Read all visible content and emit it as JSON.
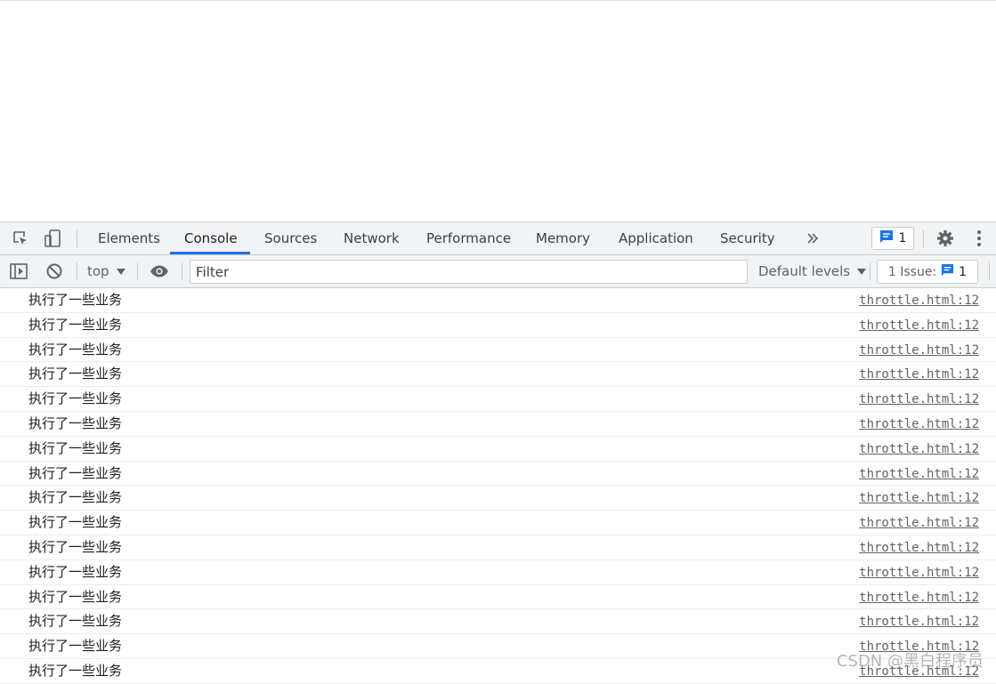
{
  "tabs": [
    "Elements",
    "Console",
    "Sources",
    "Network",
    "Performance",
    "Memory",
    "Application",
    "Security"
  ],
  "active_tab": "Console",
  "messages_badge": "1",
  "console_toolbar": {
    "context": "top",
    "filter_placeholder": "Filter",
    "levels": "Default levels",
    "issues_label": "1 Issue:",
    "issues_count": "1"
  },
  "log_rows": [
    {
      "message": "执行了一些业务",
      "source": "throttle.html:12"
    },
    {
      "message": "执行了一些业务",
      "source": "throttle.html:12"
    },
    {
      "message": "执行了一些业务",
      "source": "throttle.html:12"
    },
    {
      "message": "执行了一些业务",
      "source": "throttle.html:12"
    },
    {
      "message": "执行了一些业务",
      "source": "throttle.html:12"
    },
    {
      "message": "执行了一些业务",
      "source": "throttle.html:12"
    },
    {
      "message": "执行了一些业务",
      "source": "throttle.html:12"
    },
    {
      "message": "执行了一些业务",
      "source": "throttle.html:12"
    },
    {
      "message": "执行了一些业务",
      "source": "throttle.html:12"
    },
    {
      "message": "执行了一些业务",
      "source": "throttle.html:12"
    },
    {
      "message": "执行了一些业务",
      "source": "throttle.html:12"
    },
    {
      "message": "执行了一些业务",
      "source": "throttle.html:12"
    },
    {
      "message": "执行了一些业务",
      "source": "throttle.html:12"
    },
    {
      "message": "执行了一些业务",
      "source": "throttle.html:12"
    },
    {
      "message": "执行了一些业务",
      "source": "throttle.html:12"
    },
    {
      "message": "执行了一些业务",
      "source": "throttle.html:12"
    }
  ],
  "watermark": "CSDN @黑白程序员",
  "icons": [
    "inspect-element-icon",
    "device-toggle-icon",
    "more-tabs-icon",
    "message-icon",
    "settings-gear-icon",
    "kebab-menu-icon",
    "sidebar-toggle-icon",
    "clear-console-icon",
    "dropdown-arrow-icon",
    "eye-icon"
  ],
  "colors": {
    "accent": "#1a73e8",
    "toolbar_bg": "#f1f3f4"
  }
}
